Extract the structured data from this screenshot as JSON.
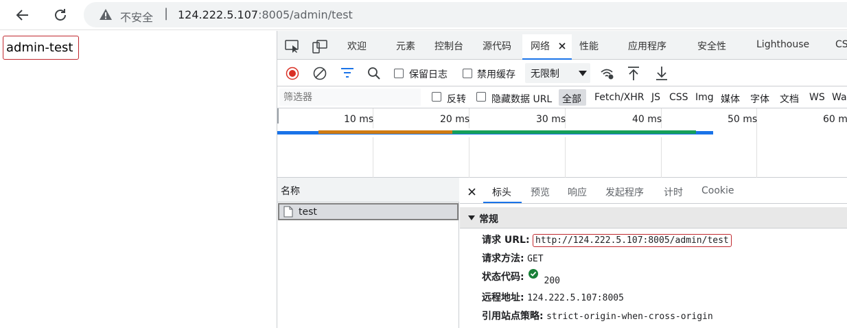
{
  "browser": {
    "insecure_label": "不安全",
    "separator": "|",
    "url_host": "124.222.5.107",
    "url_rest": ":8005/admin/test"
  },
  "page": {
    "heading": "admin-test"
  },
  "devtools": {
    "tabs": [
      "欢迎",
      "元素",
      "控制台",
      "源代码",
      "网络",
      "性能",
      "应用程序",
      "安全性",
      "Lighthouse",
      "CS"
    ],
    "active_tab_index": 4,
    "toolbar": {
      "preserve_log": "保留日志",
      "disable_cache": "禁用缓存",
      "throttle": "无限制"
    },
    "filter": {
      "placeholder": "筛选器",
      "invert": "反转",
      "hide_data_urls": "隐藏数据 URL",
      "types": [
        "全部",
        "Fetch/XHR",
        "JS",
        "CSS",
        "Img",
        "媒体",
        "字体",
        "文档",
        "WS",
        "Wa"
      ],
      "active_type_index": 0
    },
    "overview": {
      "ticks": [
        "10 ms",
        "20 ms",
        "30 ms",
        "40 ms",
        "50 ms",
        "60 ms"
      ],
      "timeline_ms": {
        "waiting_start": 4.3,
        "waiting_end": 18.3,
        "download_start": 18.3,
        "download_end": 43.7,
        "end": 45.5
      }
    },
    "requests": {
      "header": "名称",
      "items": [
        {
          "name": "test"
        }
      ]
    },
    "details": {
      "tabs": [
        "标头",
        "预览",
        "响应",
        "发起程序",
        "计时",
        "Cookie"
      ],
      "active_tab_index": 0,
      "section_title": "常规",
      "general": [
        {
          "key": "请求 URL:",
          "value": "http://124.222.5.107:8005/admin/test"
        },
        {
          "key": "请求方法:",
          "value": "GET"
        },
        {
          "key": "状态代码:",
          "value": "200"
        },
        {
          "key": "远程地址:",
          "value": "124.222.5.107:8005"
        },
        {
          "key": "引用站点策略:",
          "value": "strict-origin-when-cross-origin"
        }
      ]
    }
  },
  "colors": {
    "accent": "#1a73e8",
    "record": "#d93025",
    "highlight_box": "#c0272d",
    "status_ok": "#188038",
    "bar_waiting": "#d07c13",
    "bar_download": "#16a05a",
    "bar_total": "#1a73e8"
  }
}
